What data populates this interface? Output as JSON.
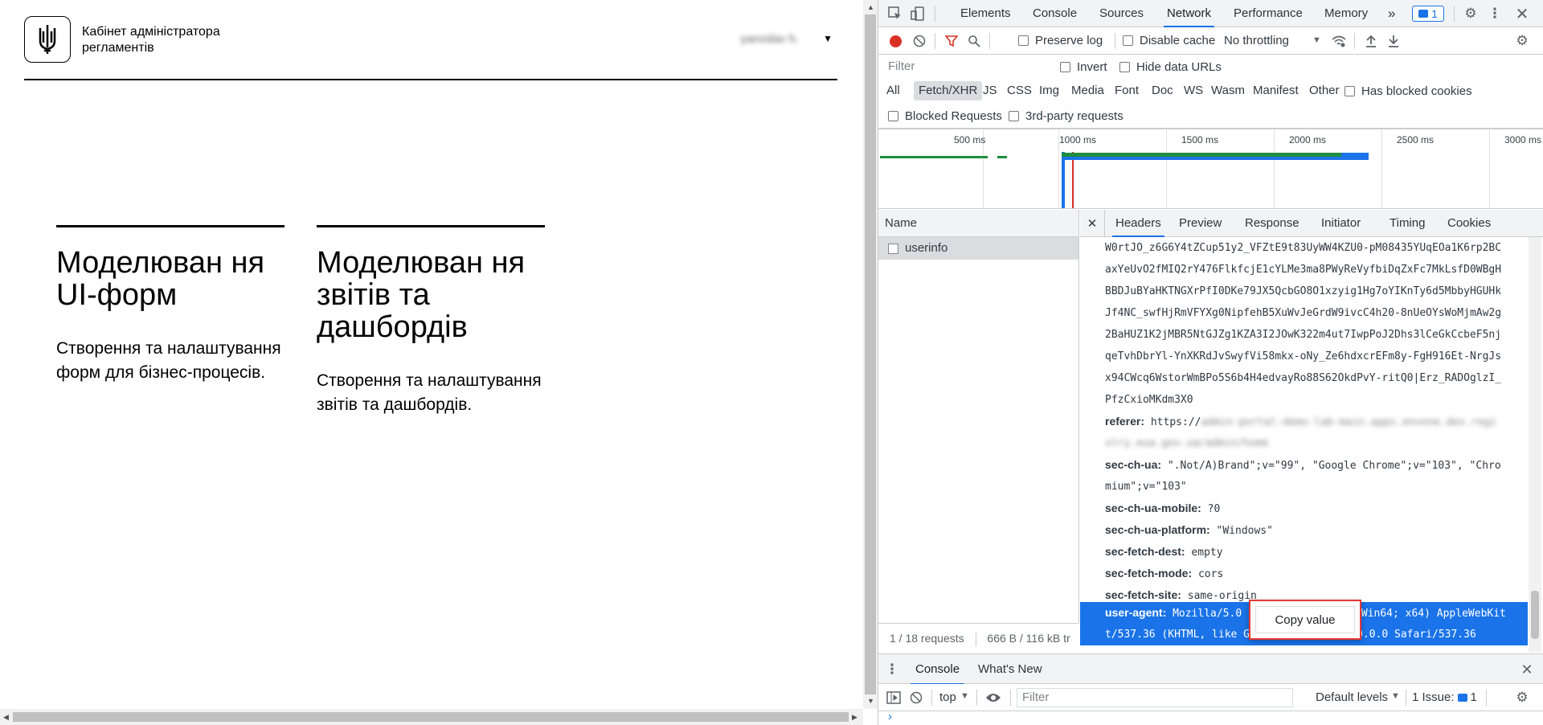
{
  "page": {
    "brand_title": "Кабінет адміністратора регламентів",
    "user_name": "yaroslav h.",
    "cards": [
      {
        "title": "Моделюван ня UI-форм",
        "description": "Створення та налаштування форм для бізнес-процесів."
      },
      {
        "title": "Моделюван ня звітів та дашбордів",
        "description": "Створення та налаштування звітів та дашбордів."
      }
    ]
  },
  "devtools": {
    "tabs": [
      "Elements",
      "Console",
      "Sources",
      "Network",
      "Performance",
      "Memory"
    ],
    "active_tab": "Network",
    "more_tabs_glyph": "»",
    "issues_badge": "1",
    "toolbar": {
      "preserve_log": "Preserve log",
      "disable_cache": "Disable cache",
      "throttling": "No throttling"
    },
    "filter": {
      "placeholder": "Filter",
      "invert": "Invert",
      "hide_data_urls": "Hide data URLs"
    },
    "type_filters": [
      "All",
      "Fetch/XHR",
      "JS",
      "CSS",
      "Img",
      "Media",
      "Font",
      "Doc",
      "WS",
      "Wasm",
      "Manifest",
      "Other"
    ],
    "active_type": "Fetch/XHR",
    "has_blocked_cookies": "Has blocked cookies",
    "blocked_requests": "Blocked Requests",
    "third_party": "3rd-party requests",
    "timeline_ticks": [
      "500 ms",
      "1000 ms",
      "1500 ms",
      "2000 ms",
      "2500 ms",
      "3000 ms"
    ],
    "name_header": "Name",
    "request_name": "userinfo",
    "summary": "1 / 18 requests",
    "transfer": "666 B / 116 kB tr",
    "detail_tabs": [
      "Headers",
      "Preview",
      "Response",
      "Initiator",
      "Timing",
      "Cookies"
    ],
    "active_detail_tab": "Headers",
    "token_lines": [
      "W0rtJO_z6G6Y4tZCup51y2_VFZtE9t83UyWW4KZU0-pM08435YUqEOa1K6rp2BC",
      "axYeUvO2fMIQ2rY476FlkfcjE1cYLMe3ma8PWyReVyfbiDqZxFc7MkLsfD0WBgH",
      "BBDJuBYaHKTNGXrPfI0DKe79JX5QcbGO8O1xzyig1Hg7oYIKnTy6d5MbbyHGUHk",
      "Jf4NC_swfHjRmVFYXg0NipfehB5XuWvJeGrdW9ivcC4h20-8nUeOYsWoMjmAw2g",
      "2BaHUZ1K2jMBR5NtGJZg1KZA3I2JOwK322m4ut7IwpPoJ2Dhs3lCeGkCcbeF5nj",
      "qeTvhDbrYl-YnXKRdJvSwyfVi58mkx-oNy_Ze6hdxcrEFm8y-FgH916Et-NrgJs",
      "x94CWcq6WstorWmBPo5S6b4H4edvayRo88S62OkdPvY-ritQ0|Erz_RADOglzI_",
      "PfzCxioMKdm3X0"
    ],
    "headers": [
      {
        "key": "referer:",
        "value": "https://",
        "blurred": "admin-portal-demo-lab-main.apps.envone.dev.regi"
      },
      {
        "key": "",
        "value": "",
        "blurred": "stry.eua.gov.ua/admin/home"
      },
      {
        "key": "sec-ch-ua:",
        "value": "\".Not/A)Brand\";v=\"99\", \"Google Chrome\";v=\"103\", \"Chro"
      },
      {
        "key": "",
        "value": "mium\";v=\"103\""
      },
      {
        "key": "sec-ch-ua-mobile:",
        "value": "?0"
      },
      {
        "key": "sec-ch-ua-platform:",
        "value": "\"Windows\""
      },
      {
        "key": "sec-fetch-dest:",
        "value": "empty"
      },
      {
        "key": "sec-fetch-mode:",
        "value": "cors"
      },
      {
        "key": "sec-fetch-site:",
        "value": "same-origin"
      }
    ],
    "user_agent": {
      "key": "user-agent:",
      "line1": "Mozilla/5.0 (Windows NT 10.0; Win64; x64) AppleWebKit",
      "line2": "t/537.36 (KHTML, like Gecko) Chrome/103.0.0.0 Safari/537.36"
    },
    "context_menu_item": "Copy value",
    "drawer_tabs": [
      "Console",
      "What's New"
    ],
    "console": {
      "context": "top",
      "filter_placeholder": "Filter",
      "levels": "Default levels",
      "issues": "1 Issue:",
      "issues_count": "1",
      "prompt": "›"
    }
  }
}
